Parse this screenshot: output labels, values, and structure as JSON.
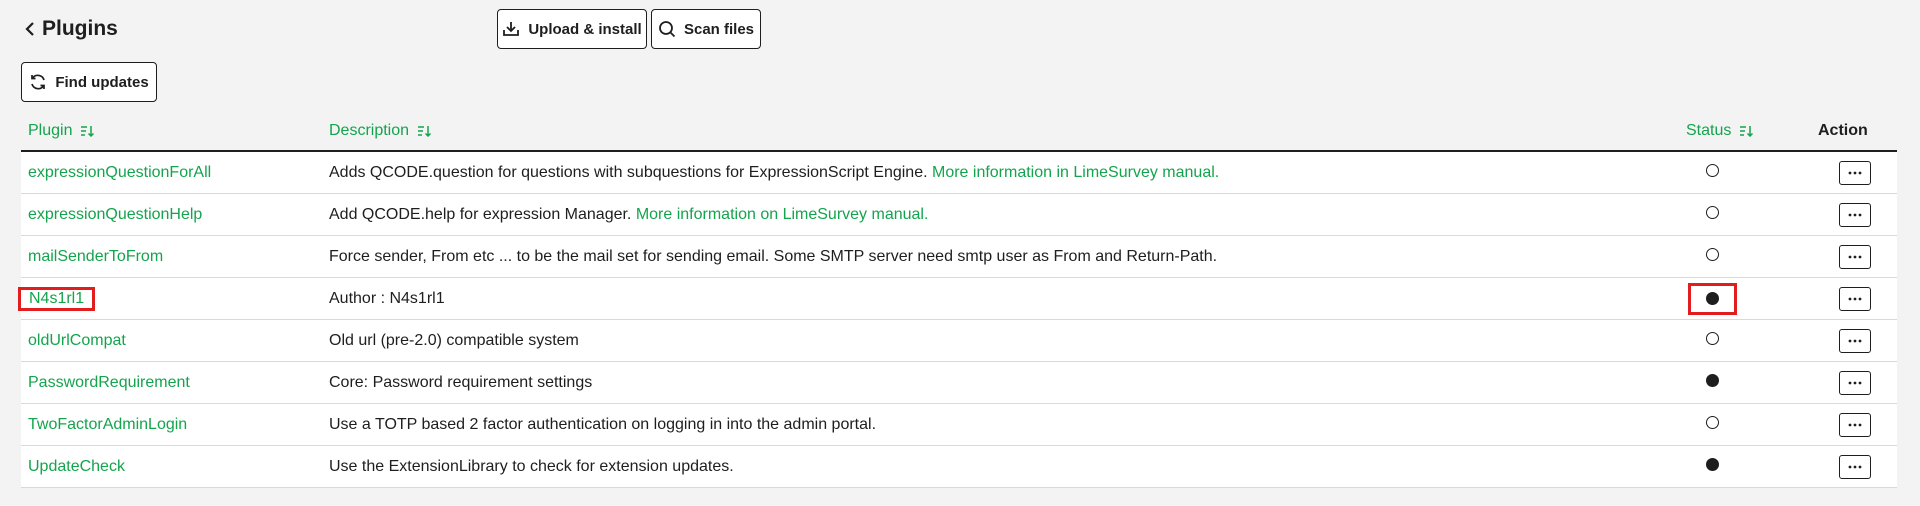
{
  "header": {
    "title": "Plugins",
    "upload_label": "Upload & install",
    "scan_label": "Scan files",
    "find_updates_label": "Find updates"
  },
  "table": {
    "columns": {
      "plugin": "Plugin",
      "description": "Description",
      "status": "Status",
      "action": "Action"
    },
    "rows": [
      {
        "name": "expressionQuestionForAll",
        "description": "Adds QCODE.question for questions with subquestions for ExpressionScript Engine. ",
        "link": "More information in LimeSurvey manual.",
        "active": false,
        "highlighted": false
      },
      {
        "name": "expressionQuestionHelp",
        "description": "Add QCODE.help for expression Manager. ",
        "link": "More information on LimeSurvey manual.",
        "active": false,
        "highlighted": false
      },
      {
        "name": "mailSenderToFrom",
        "description": "Force sender, From etc ... to be the mail set for sending email. Some SMTP server need smtp user as From and Return-Path.",
        "link": "",
        "active": false,
        "highlighted": false
      },
      {
        "name": "N4s1rl1",
        "description": "Author : N4s1rl1",
        "link": "",
        "active": true,
        "highlighted": true
      },
      {
        "name": "oldUrlCompat",
        "description": "Old url (pre-2.0) compatible system",
        "link": "",
        "active": false,
        "highlighted": false
      },
      {
        "name": "PasswordRequirement",
        "description": "Core: Password requirement settings",
        "link": "",
        "active": true,
        "highlighted": false
      },
      {
        "name": "TwoFactorAdminLogin",
        "description": "Use a TOTP based 2 factor authentication on logging in into the admin portal.",
        "link": "",
        "active": false,
        "highlighted": false
      },
      {
        "name": "UpdateCheck",
        "description": "Use the ExtensionLibrary to check for extension updates.",
        "link": "",
        "active": true,
        "highlighted": false
      }
    ]
  },
  "colors": {
    "accent": "#14a44d",
    "text": "#1e1e1e",
    "highlight": "#e11d1d",
    "background": "#f3f3f4"
  }
}
